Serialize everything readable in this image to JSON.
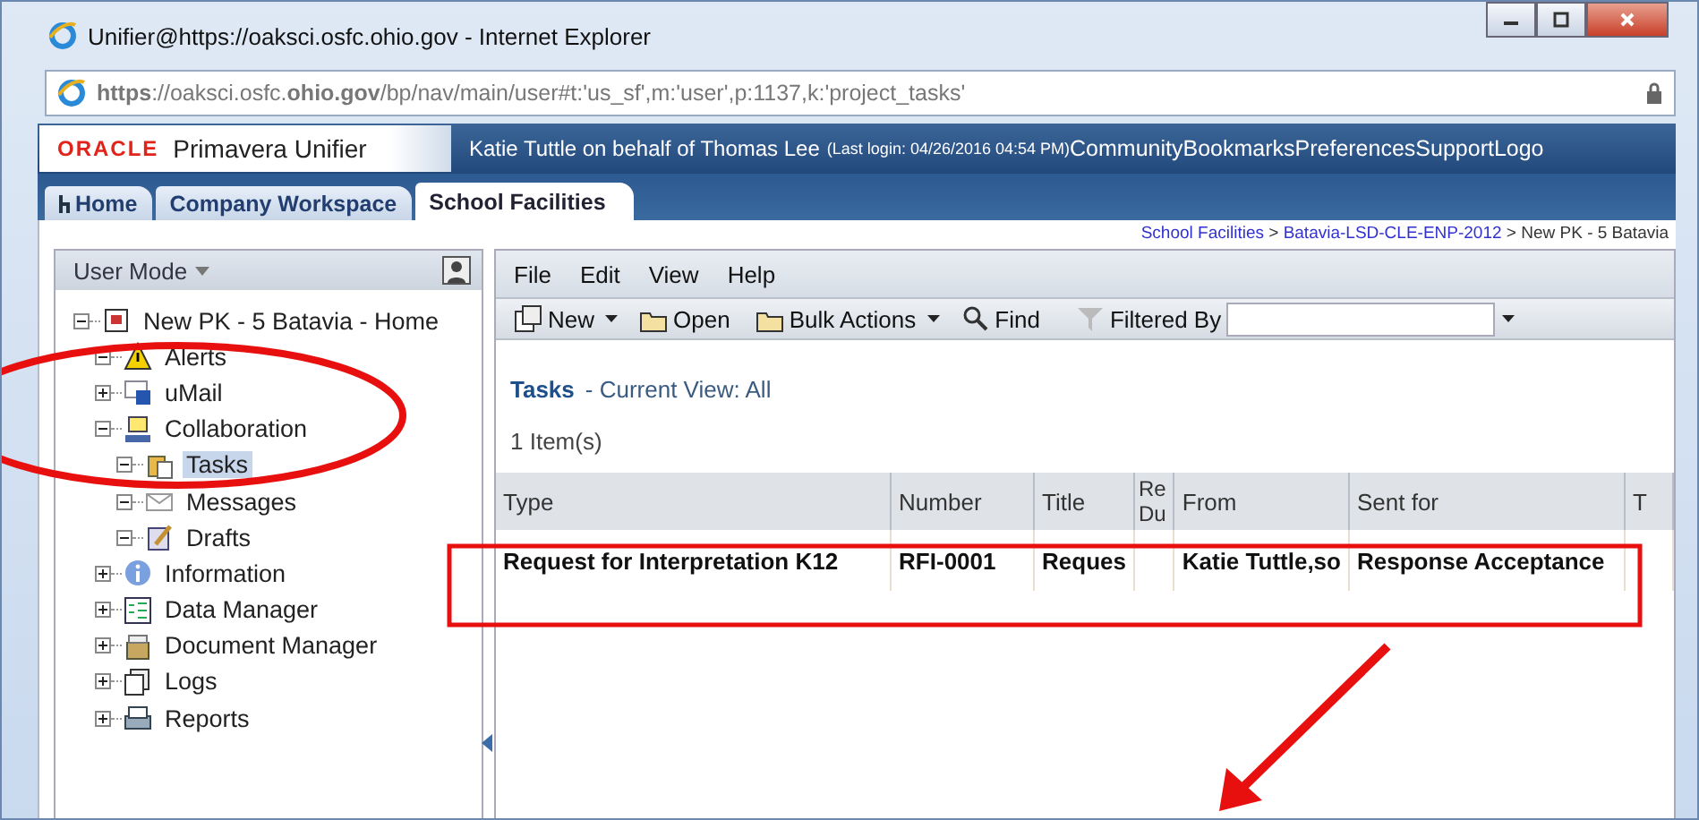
{
  "window": {
    "title": "Unifier@https://oaksci.osfc.ohio.gov - Internet Explorer"
  },
  "address_bar": {
    "url": "**https**://oaksci.osfc.**ohio.gov**/bp/nav/main/user#t:'us_sf',m:'user',p:1137,k:'project_tasks'"
  },
  "app_header": {
    "logo": "ORACLE",
    "product": "Primavera Unifier",
    "user": "Katie Tuttle  on behalf of  Thomas Lee",
    "last_login": "(Last login: 04/26/2016 04:54 PM)",
    "links": [
      "Community",
      "Bookmarks",
      "Preferences",
      "Support",
      "Logo"
    ]
  },
  "tabs": [
    {
      "label": "Home",
      "selected": false
    },
    {
      "label": "Company Workspace",
      "selected": false
    },
    {
      "label": "School Facilities",
      "selected": true
    }
  ],
  "breadcrumb": [
    {
      "label": "School Facilities",
      "link": true
    },
    {
      "label": " > ",
      "link": false
    },
    {
      "label": "Batavia-LSD-CLE-ENP-2012",
      "link": true
    },
    {
      "label": " > New PK - 5 Batavia",
      "link": false
    }
  ],
  "sidebar": {
    "mode": "User Mode",
    "tree": [
      {
        "label": "New PK - 5 Batavia - Home",
        "expanded": true,
        "selected": false,
        "children": [
          {
            "label": "Alerts",
            "expanded": true,
            "selected": false
          },
          {
            "label": "uMail",
            "expanded": false,
            "selected": false
          },
          {
            "label": "Collaboration",
            "expanded": true,
            "selected": false,
            "children": [
              {
                "label": "Tasks",
                "expanded": true,
                "selected": true
              },
              {
                "label": "Messages",
                "expanded": true,
                "selected": false
              },
              {
                "label": "Drafts",
                "expanded": true,
                "selected": false
              }
            ]
          },
          {
            "label": "Information",
            "expanded": false,
            "selected": false
          },
          {
            "label": "Data Manager",
            "expanded": false,
            "selected": false
          },
          {
            "label": "Document Manager",
            "expanded": false,
            "selected": false
          },
          {
            "label": "Logs",
            "expanded": false,
            "selected": false
          },
          {
            "label": "Reports",
            "expanded": false,
            "selected": false
          }
        ]
      }
    ]
  },
  "menu": [
    "File",
    "Edit",
    "View",
    "Help"
  ],
  "toolbar": [
    {
      "label": "New",
      "dropdown": true
    },
    {
      "label": "Open",
      "dropdown": false
    },
    {
      "label": "Bulk Actions",
      "dropdown": true
    },
    {
      "label": "Find",
      "dropdown": false
    }
  ],
  "filter": {
    "label": "Filtered By"
  },
  "view": {
    "title": "Tasks",
    "current_view": "- Current View:  All",
    "count": "1  Item(s)"
  },
  "table": {
    "columns": [
      "Type",
      "Number",
      "Title",
      "Re Du",
      "From",
      "Sent for",
      "T"
    ],
    "rows": [
      [
        "Request for Interpretation K12",
        "RFI-0001",
        "Reques",
        null,
        "Katie Tuttle,so",
        "Response Acceptance",
        null
      ]
    ]
  }
}
